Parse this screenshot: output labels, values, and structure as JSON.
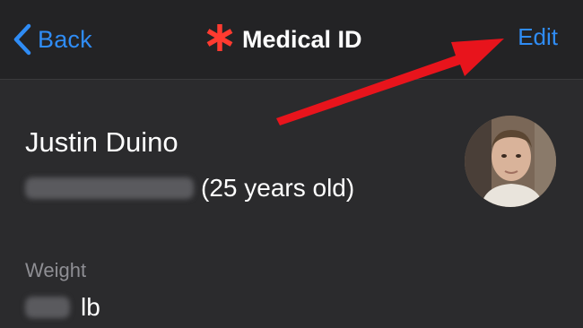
{
  "nav": {
    "back_label": "Back",
    "title": "Medical ID",
    "edit_label": "Edit",
    "accent_color": "#2f8cf5",
    "title_icon_color": "#ff3b30"
  },
  "profile": {
    "name": "Justin Duino",
    "age_text": "(25 years old)",
    "avatar_icon": "person-photo"
  },
  "weight": {
    "label": "Weight",
    "unit": "lb"
  },
  "annotation": {
    "arrow_color": "#e8141c"
  }
}
